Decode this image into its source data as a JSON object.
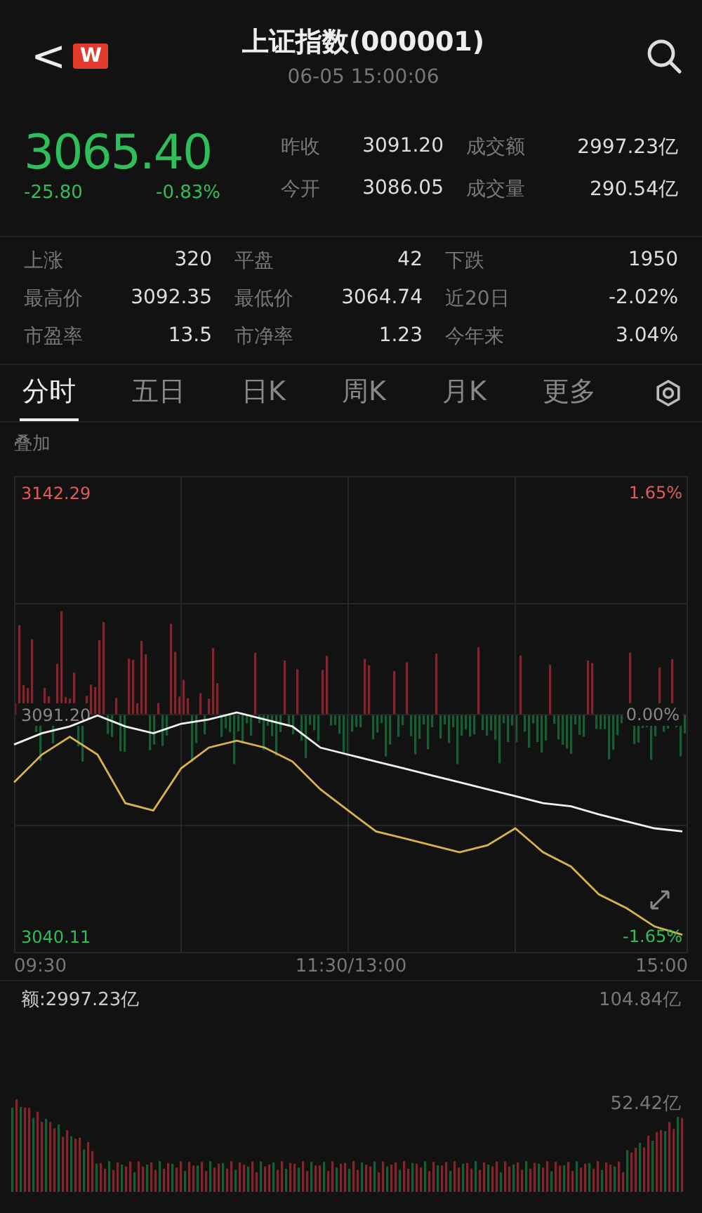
{
  "header": {
    "back": "<",
    "badge": "W",
    "title": "上证指数(000001)",
    "time": "06-05 15:00:06"
  },
  "quote": {
    "price": "3065.40",
    "change": "-25.80",
    "percent": "-0.83%"
  },
  "top_stats": [
    {
      "label": "昨收",
      "value": "3091.20"
    },
    {
      "label": "成交额",
      "value": "2997.23亿"
    },
    {
      "label": "今开",
      "value": "3086.05"
    },
    {
      "label": "成交量",
      "value": "290.54亿"
    }
  ],
  "stats": [
    {
      "label": "上涨",
      "value": "320"
    },
    {
      "label": "平盘",
      "value": "42"
    },
    {
      "label": "下跌",
      "value": "1950"
    },
    {
      "label": "最高价",
      "value": "3092.35"
    },
    {
      "label": "最低价",
      "value": "3064.74"
    },
    {
      "label": "近20日",
      "value": "-2.02%"
    },
    {
      "label": "市盈率",
      "value": "13.5"
    },
    {
      "label": "市净率",
      "value": "1.23"
    },
    {
      "label": "今年来",
      "value": "3.04%"
    }
  ],
  "tabs": [
    {
      "label": "分时",
      "selected": true
    },
    {
      "label": "五日",
      "selected": false
    },
    {
      "label": "日K",
      "selected": false
    },
    {
      "label": "周K",
      "selected": false
    },
    {
      "label": "月K",
      "selected": false
    },
    {
      "label": "更多",
      "selected": false
    }
  ],
  "overlay_label": "叠加",
  "price_chart": {
    "right_labels": [
      "1.65%",
      "0.00%",
      "-1.65%"
    ],
    "time_labels": [
      "09:30",
      "11:30/13:00",
      "15:00"
    ],
    "chart_data": {
      "type": "line",
      "grid": true,
      "ylim": [
        3036.23,
        3146.17
      ],
      "yticks": [
        {
          "value": 3142.29,
          "label": "3142.29"
        },
        {
          "value": 3091.2,
          "label": "3091.20"
        },
        {
          "value": 3040.11,
          "label": "3040.11"
        }
      ],
      "series": [
        {
          "color": "#f0f0f0",
          "values": [
            3084.3,
            3086.9,
            3088.5,
            3091.0,
            3088.5,
            3086.9,
            3089.1,
            3090.1,
            3091.7,
            3090.1,
            3088.5,
            3083.6,
            3082.0,
            3080.4,
            3078.8,
            3077.2,
            3075.6,
            3074.0,
            3072.4,
            3070.8,
            3070.1,
            3068.2,
            3066.6,
            3065.0,
            3064.3
          ]
        },
        {
          "color": "#d9b24c",
          "values": [
            3075.6,
            3082.0,
            3086.1,
            3082.0,
            3070.8,
            3069.1,
            3078.8,
            3083.6,
            3085.2,
            3083.6,
            3080.4,
            3074.0,
            3069.1,
            3064.3,
            3062.7,
            3061.1,
            3059.5,
            3061.1,
            3065.0,
            3059.5,
            3056.2,
            3049.8,
            3046.6,
            3042.4,
            3040.5
          ]
        }
      ]
    }
  },
  "volume": {
    "total": "额:2997.23亿",
    "max_label": "104.84亿",
    "mid_label": "52.42亿"
  }
}
